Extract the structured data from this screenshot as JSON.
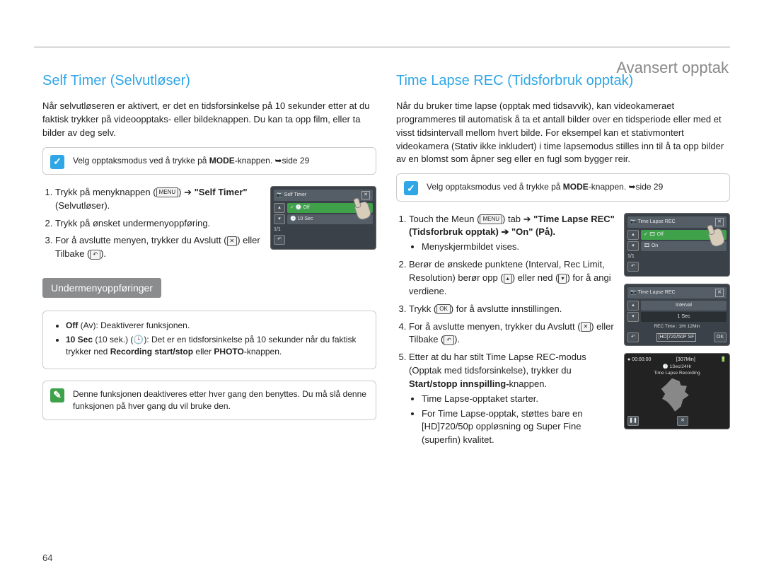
{
  "chapter": "Avansert opptak",
  "page_number": "64",
  "left": {
    "heading": "Self Timer (Selvutløser)",
    "intro": "Når selvutløseren er aktivert, er det en tidsforsinkelse på 10 sekunder etter at du faktisk trykker på videoopptaks- eller bildeknappen. Du kan ta opp film, eller ta bilder av deg selv.",
    "note_mode": "Velg opptaksmodus ved å trykke på ",
    "note_mode_btn": "MODE",
    "note_mode_tail": "-knappen. ➥side 29",
    "steps": {
      "s1a": "Trykk på menyknappen (",
      "s1_menu": "MENU",
      "s1b": ") ➔ ",
      "s1_bold": "\"Self Timer\"",
      "s1_tail": " (Selvutløser).",
      "s2": "Trykk på ønsket undermenyoppføring.",
      "s3a": "For å avslutte menyen, trykker du Avslutt (",
      "s3_x": "✕",
      "s3b": ") eller Tilbake (",
      "s3_back": "↶",
      "s3c": ")."
    },
    "lcd": {
      "title": "Self Timer",
      "opt_off": "✓ 🕒 Off",
      "opt_10": "🕒 10 Sec",
      "page": "1/1"
    },
    "sub_header": "Undermenyoppføringer",
    "opt1_bold": "Off",
    "opt1_paren": " (Av): ",
    "opt1_txt": "Deaktiverer funksjonen.",
    "opt2_bold": "10 Sec",
    "opt2_paren": " (10 sek.) (🕒): ",
    "opt2_txt": "Det er en tidsforsinkelse på 10 sekunder når du faktisk trykker ned ",
    "opt2_rec": "Recording start/stop",
    "opt2_mid": " eller ",
    "opt2_photo": "PHOTO",
    "opt2_tail": "-knappen.",
    "note_bottom": "Denne funksjonen deaktiveres etter hver gang den benyttes. Du må slå denne funksjonen på hver gang du vil bruke den."
  },
  "right": {
    "heading": "Time Lapse REC (Tidsforbruk opptak)",
    "intro": "Når du bruker time lapse (opptak med tidsavvik), kan videokameraet programmeres til automatisk å ta et antall bilder over en tidsperiode eller med et visst tidsintervall mellom hvert bilde. For eksempel kan et stativmontert videokamera (Stativ ikke inkludert) i time lapsemodus stilles inn til å ta opp bilder av en blomst som åpner seg eller en fugl som bygger reir.",
    "note_mode": "Velg opptaksmodus ved å trykke på ",
    "note_mode_btn": "MODE",
    "note_mode_tail": "-knappen. ➥side 29",
    "steps": {
      "s1a": "Touch the Meun (",
      "s1_menu": "MENU",
      "s1b": ") tab ➔ ",
      "s1_bold": "\"Time Lapse REC\" (Tidsforbruk opptak) ➔ \"On\" (På).",
      "s1_bul": "Menyskjermbildet vises.",
      "s2a": "Berør de ønskede punktene (Interval, Rec Limit, Resolution) berør opp (",
      "s2_up": "▴",
      "s2b": ") eller ned (",
      "s2_dn": "▾",
      "s2c": ") for å angi verdiene.",
      "s3a": "Trykk (",
      "s3_ok": "OK",
      "s3b": ") for å avslutte innstillingen.",
      "s4a": "For å avslutte menyen, trykker du Avslutt (",
      "s4_x": "✕",
      "s4b": ") eller Tilbake (",
      "s4_back": "↶",
      "s4c": ").",
      "s5a": "Etter at du har stilt Time Lapse REC-modus (Opptak med tidsforsinkelse), trykker du ",
      "s5_bold": "Start/stopp innspilling-",
      "s5_tail": "knappen.",
      "s5_b1": "Time Lapse-opptaket starter.",
      "s5_b2": "For Time Lapse-opptak, støttes bare en [HD]720/50p oppløsning og Super Fine (superfin) kvalitet."
    },
    "lcd1": {
      "title": "Time Lapse REC",
      "opt_off": "✓ 🎞 Off",
      "opt_on": "🎞 On",
      "page": "1/1"
    },
    "lcd2": {
      "title": "Time Lapse REC",
      "interval_lbl": "Interval",
      "interval_val": "1   Sec",
      "rectime": "REC Time : 1Hr 12Min",
      "res": "[HD]720/50P SF",
      "ok": "OK"
    },
    "lcd3": {
      "time": "00:00:00",
      "remain": "[307Min]",
      "sub1": "1Sec/24Hr",
      "sub2": "Time Lapse Recording"
    }
  }
}
